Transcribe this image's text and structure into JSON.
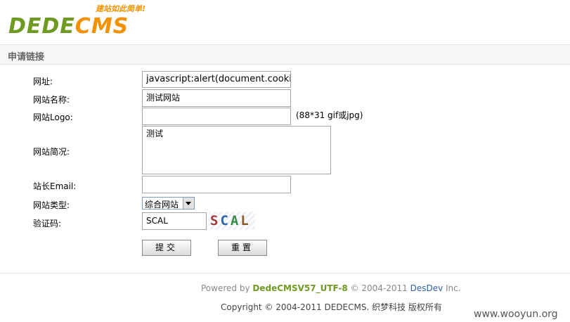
{
  "header": {
    "logo_dede": "DEDE",
    "logo_cms": "CMS",
    "slogan": "建站如此简单!"
  },
  "section_title": "申请链接",
  "form": {
    "url": {
      "label": "网址:",
      "value": "javascript:alert(document.cooki"
    },
    "site_name": {
      "label": "网站名称:",
      "value": "测试网站"
    },
    "logo": {
      "label": "网站Logo:",
      "value": "",
      "hint": "(88*31 gif或jpg)"
    },
    "description": {
      "label": "网站简况:",
      "value": "测试"
    },
    "email": {
      "label": "站长Email:",
      "value": ""
    },
    "site_type": {
      "label": "网站类型:",
      "selected": "综合网站"
    },
    "captcha": {
      "label": "验证码:",
      "value": "SCAL",
      "image_chars": [
        "S",
        "C",
        "A",
        "L"
      ]
    },
    "submit_label": "提交",
    "reset_label": "重置"
  },
  "footer": {
    "powered_prefix": "Powered by",
    "powered_version": "DedeCMSV57_UTF-8",
    "powered_years": "© 2004-2011",
    "powered_company": "DesDev",
    "powered_suffix": "Inc.",
    "copyright": "Copyright © 2004-2011 DEDECMS. 织梦科技 版权所有"
  },
  "watermark": "www.wooyun.org"
}
